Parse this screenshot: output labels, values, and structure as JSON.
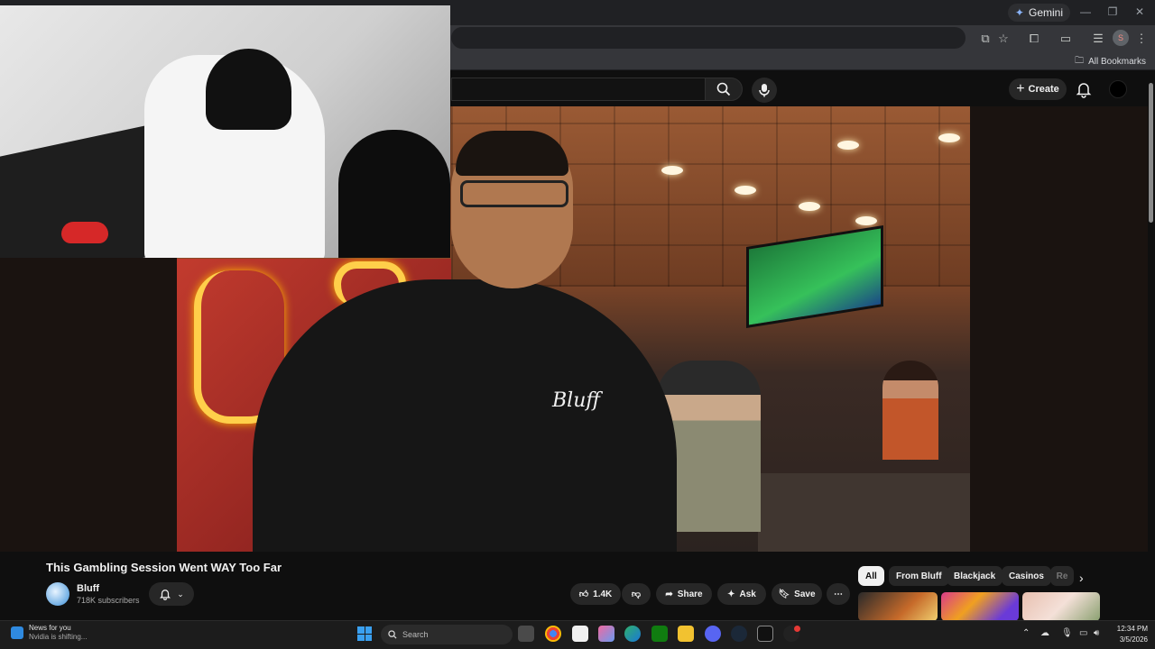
{
  "browser": {
    "gemini_label": "Gemini",
    "bookmarks_label": "All Bookmarks",
    "profile_initial": "S"
  },
  "youtube": {
    "create_label": "Create",
    "video": {
      "title": "This Gambling Session Went WAY Too Far",
      "shirt_logo": "Bluff"
    },
    "channel": {
      "name": "Bluff",
      "subscribers": "718K subscribers"
    },
    "actions": {
      "likes": "1.4K",
      "share": "Share",
      "ask": "Ask",
      "save": "Save"
    },
    "chips": [
      "All",
      "From Bluff",
      "Blackjack",
      "Casinos",
      "Re"
    ]
  },
  "taskbar": {
    "news_title": "News for you",
    "news_sub": "Nvidia is shifting...",
    "search_placeholder": "Search",
    "time": "12:34 PM",
    "date": "3/5/2026"
  },
  "colors": {
    "yt_bg": "#0f0f0f",
    "chip_active_bg": "#f1f1f1",
    "pill_bg": "#272727",
    "notify_red": "#e53935"
  }
}
